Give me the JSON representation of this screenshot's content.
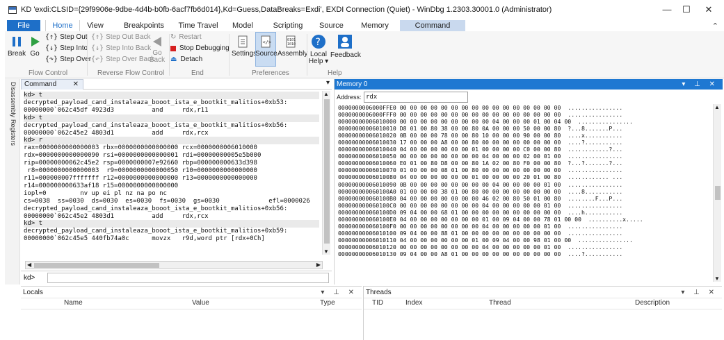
{
  "window": {
    "title": "KD 'exdi:CLSID={29f9906e-9dbe-4d4b-b0fb-6acf7fb6d014},Kd=Guess,DataBreaks=Exdi', EXDI Connection (Quiet) - WinDbg 1.2303.30001.0 (Administrator)",
    "minimize": "—",
    "maximize": "☐",
    "close": "✕"
  },
  "ribbon_tabs": [
    "File",
    "Home",
    "View",
    "Breakpoints",
    "Time Travel",
    "Model",
    "Scripting",
    "Source",
    "Memory",
    "Command"
  ],
  "ribbon": {
    "flow": {
      "break": "Break",
      "go": "Go",
      "step_out": "Step Out",
      "step_into": "Step Into",
      "step_over": "Step Over",
      "label": "Flow Control"
    },
    "reverse": {
      "step_out_back": "Step Out Back",
      "step_into_back": "Step Into Back",
      "step_over_back": "Step Over Back",
      "go_back_1": "Go",
      "go_back_2": "Back",
      "label": "Reverse Flow Control"
    },
    "end": {
      "restart": "Restart",
      "stop": "Stop Debugging",
      "detach": "Detach",
      "label": "End"
    },
    "preferences": {
      "settings": "Settings",
      "source": "Source",
      "assembly": "Assembly",
      "label": "Preferences"
    },
    "help": {
      "local_help_1": "Local",
      "local_help_2": "Help ▾",
      "feedback": "Feedback",
      "label": "Help"
    }
  },
  "side_tabs": [
    "Disassembly",
    "Registers"
  ],
  "command": {
    "tab_label": "Command",
    "tab_close": "✕",
    "prompt": "kd>",
    "input": "",
    "lines": [
      "kd> t",
      "decrypted_payload_cand_instaleaza_booot_ista_e_bootkit_malitios+0xb53:",
      "00000000`062c45df 4923d3          and     rdx,r11",
      "kd> t",
      "decrypted_payload_cand_instaleaza_booot_ista_e_bootkit_malitios+0xb56:",
      "00000000`062c45e2 4803d1          add     rdx,rcx",
      "kd> r",
      "rax=0000000000000003 rbx=0000000000000000 rcx=0000000006010000",
      "rdx=0000000000000090 rsi=0000000000000001 rdi=00000000005e5b000",
      "rip=00000000062c45e2 rsp=0000000007e92660 rbp=000000000633d398",
      " r8=0000000000000003  r9=0000000000000050 r10=0000000000000000",
      "r11=000000007fffffff r12=0000000000000000 r13=0000000000000000",
      "r14=000000000633af18 r15=0000000000000000",
      "iopl=0         nv up ei pl nz na po nc",
      "cs=0038  ss=0030  ds=0030  es=0030  fs=0030  gs=0030             efl=0000026",
      "decrypted_payload_cand_instaleaza_booot_ista_e_bootkit_malitios+0xb56:",
      "00000000`062c45e2 4803d1          add     rdx,rcx",
      "kd> t",
      "decrypted_payload_cand_instaleaza_booot_ista_e_bootkit_malitios+0xb59:",
      "00000000`062c45e5 440fb74a0c      movzx   r9d,word ptr [rdx+0Ch]"
    ],
    "highlight_rows": [
      0,
      3,
      6,
      17
    ]
  },
  "memory": {
    "title": "Memory 0",
    "address_label": "Address:",
    "address_value": "rdx",
    "lines": [
      "0000000006000FFE0 00 00 00 00 00 00 00 00 00 00 00 00 00 00 00 00  ................",
      "0000000006000FFF0 00 00 00 00 00 00 00 00 00 00 00 00 00 00 00 00  ................",
      "00000000006010000 00 00 00 00 00 00 00 00 00 04 00 00 00 01 00 04 00  ................",
      "00000000006010010 D8 01 00 80 38 00 00 80 0A 00 00 00 50 00 00 80  ?...8.......P...",
      "00000000006010020 0B 00 00 00 78 00 00 80 10 00 00 00 90 00 00 80  ....x...........",
      "00000000006010030 17 00 00 00 A8 00 00 80 00 00 00 00 00 00 00 00  ....?...........",
      "00000000006010040 04 00 00 00 00 00 00 01 00 00 00 00 C0 00 00 80  ............?...",
      "00000000006010050 00 00 00 00 00 00 00 00 04 00 00 00 02 00 01 00  ................",
      "00000000006010060 E0 01 00 80 D8 00 00 80 1A 02 00 80 F0 00 00 80  ?...?.......?...",
      "00000000006010070 01 00 00 00 08 01 00 80 00 00 00 00 00 00 00 00  ................",
      "00000000006010080 04 00 00 00 00 00 00 01 00 00 00 00 20 01 00 80  ............ ...",
      "00000000006010090 0B 00 00 00 00 00 00 00 00 04 00 00 00 00 01 00  ................",
      "000000000060100A0 01 00 00 00 38 01 00 80 00 00 00 00 00 00 00 00  ....8...........",
      "000000000060100B0 04 00 00 00 00 00 00 00 46 02 00 80 50 01 00 80  ........F...P...",
      "000000000060100C0 00 00 00 00 00 00 00 00 04 00 00 00 00 00 01 00  ................",
      "000000000060100D0 09 04 00 00 68 01 00 00 00 00 00 00 00 00 00 00  ....h...........",
      "000000000060100E0 04 00 00 00 00 00 00 00 01 00 09 04 00 00 78 01 00 00  ..........x.....",
      "000000000060100F0 00 00 00 00 00 00 00 00 04 00 00 00 00 00 01 00  ................",
      "00000000006010100 09 04 00 00 88 01 00 00 00 00 00 00 00 00 00 00  ................",
      "00000000006010110 04 00 00 00 00 00 00 01 00 09 04 00 00 98 01 00 00  ................",
      "00000000006010120 00 00 00 00 00 00 00 00 04 00 00 00 00 00 01 00  ................",
      "00000000006010130 09 04 00 00 A8 01 00 00 00 00 00 00 00 00 00 00  ....?..........."
    ]
  },
  "locals": {
    "title": "Locals",
    "columns": [
      "Name",
      "Value",
      "Type"
    ]
  },
  "threads": {
    "title": "Threads",
    "columns": [
      "TID",
      "Index",
      "Thread",
      "Description"
    ]
  },
  "pane_controls": "▾ ⊥ ✕"
}
